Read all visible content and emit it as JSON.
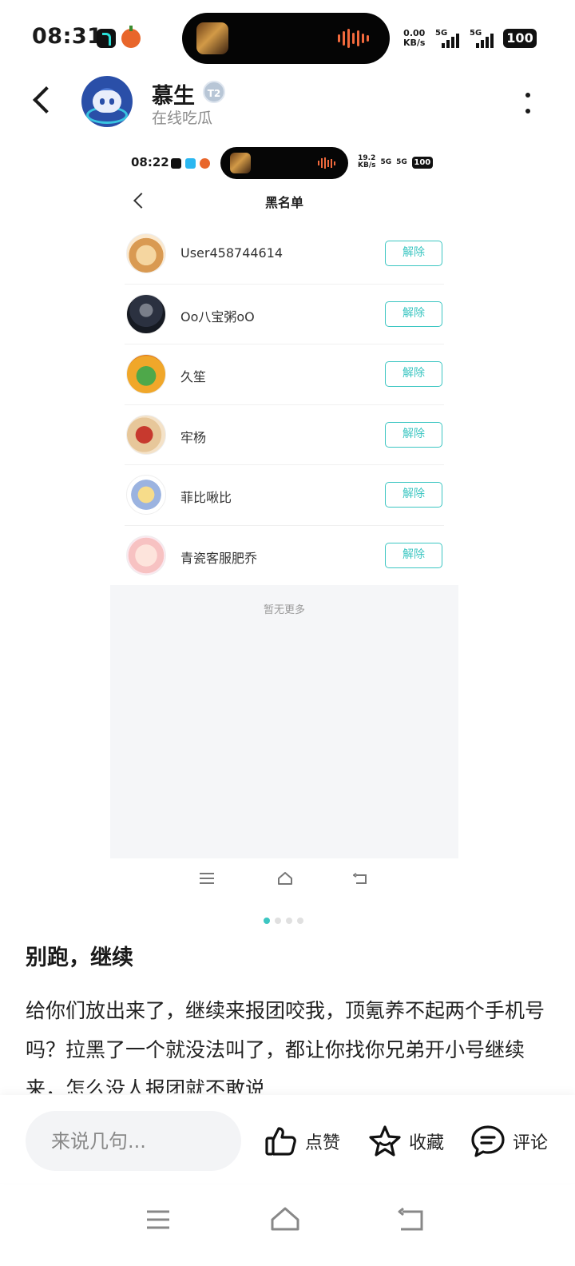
{
  "status_bar": {
    "time": "08:31",
    "net_speed_value": "0.00",
    "net_speed_unit": "KB/s",
    "signal_1": "5G",
    "signal_2": "5G",
    "battery": "100"
  },
  "post": {
    "author_name": "慕生",
    "author_status": "在线吃瓜",
    "title": "别跑，继续",
    "body": "给你们放出来了，继续来报团咬我，顶氪养不起两个手机号吗？拉黑了一个就没法叫了，都让你找你兄弟开小号继续来，怎么没人报团就不敢说"
  },
  "screenshot": {
    "time": "08:22",
    "net_speed_value": "19.2",
    "net_speed_unit": "KB/s",
    "signal_1": "5G",
    "signal_2": "5G",
    "battery": "100",
    "page_title": "黑名单",
    "unblock_label": "解除",
    "no_more_text": "暂无更多",
    "blocked_users": [
      {
        "name": "User458744614"
      },
      {
        "name": "Oo八宝粥oO"
      },
      {
        "name": "久笙"
      },
      {
        "name": "牢杨"
      },
      {
        "name": "菲比啾比"
      },
      {
        "name": "青瓷客服肥乔"
      }
    ]
  },
  "pager": {
    "total": 4,
    "active": 1
  },
  "action_bar": {
    "comment_placeholder": "来说几句...",
    "like_label": "点赞",
    "favorite_label": "收藏",
    "comment_label": "评论"
  },
  "colors": {
    "accent": "#3cc6c2",
    "text_primary": "#1a1a1a",
    "text_secondary": "#8c8c8c",
    "input_bg": "#f3f4f6"
  }
}
